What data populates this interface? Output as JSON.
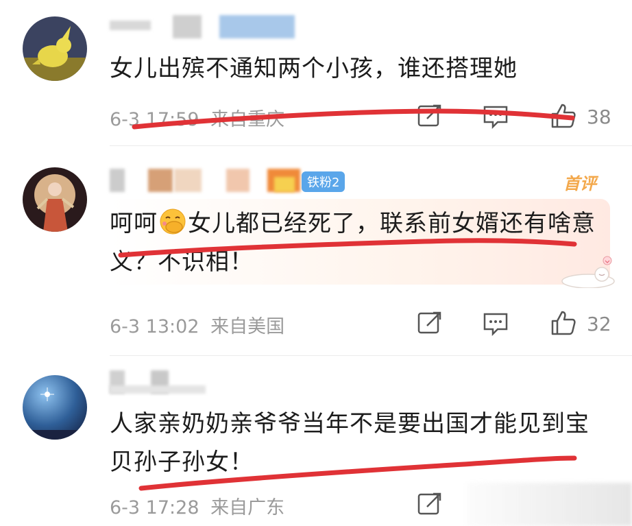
{
  "comments": [
    {
      "text": "女儿出殡不通知两个小孩，谁还搭理她",
      "date": "6-3 17:59",
      "location": "来自重庆",
      "likes": "38"
    },
    {
      "badge_first": "首评",
      "fan_badge": "铁粉2",
      "text_before_emoji": "呵呵",
      "emoji": "face-with-hand-over-mouth-emoji",
      "text_after_emoji": "女儿都已经死了，联系前女婿还有啥意义？不识相！",
      "date": "6-3 13:02",
      "location": "来自美国",
      "likes": "32"
    },
    {
      "text": "人家亲奶奶亲爷爷当年不是要出国才能见到宝贝孙子孙女！",
      "date": "6-3 17:28",
      "location": "来自广东"
    }
  ],
  "icons": [
    "share-icon",
    "comment-icon",
    "like-icon"
  ],
  "colors": {
    "annotation_red": "#e03236",
    "meta_gray": "#9a9a9a",
    "badge_orange": "#f3a84b",
    "fan_blue": "#5aa6ea"
  }
}
